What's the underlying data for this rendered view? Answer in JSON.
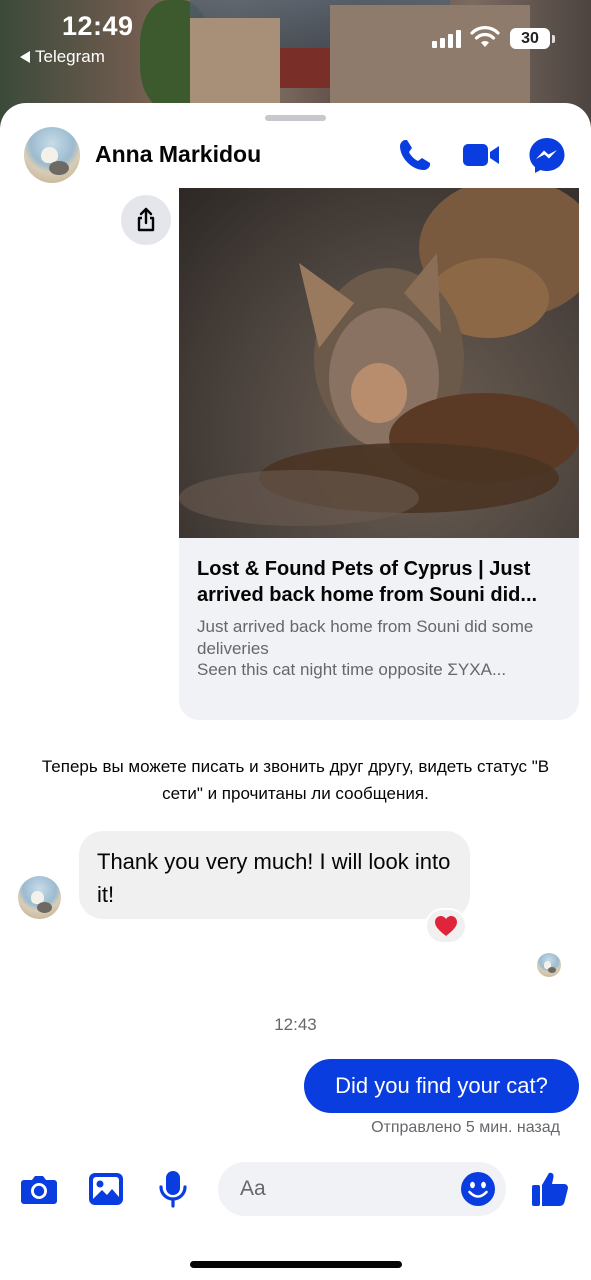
{
  "status_bar": {
    "time": "12:49",
    "back_app": "Telegram",
    "battery": "30"
  },
  "header": {
    "contact_name": "Anna Markidou",
    "icons": [
      "phone-icon",
      "video-camera-icon",
      "messenger-icon"
    ]
  },
  "link_preview": {
    "title": "Lost & Found Pets of Cyprus | Just arrived back home from Souni did...",
    "description": "Just arrived back home from Souni did some deliveries\nSeen this cat night time opposite ΣΥΧΑ..."
  },
  "system_message": "Теперь вы можете писать и звонить друг другу, видеть статус \"В сети\" и прочитаны ли сообщения.",
  "incoming_message": {
    "text": "Thank you very much! I will look into it!",
    "reaction": "heart"
  },
  "timestamp": "12:43",
  "outgoing_message": {
    "text": "Did you find your cat?",
    "status": "Отправлено 5 мин. назад"
  },
  "composer": {
    "placeholder": "Aa",
    "icons": [
      "camera-icon",
      "gallery-icon",
      "microphone-icon",
      "emoji-icon",
      "thumbs-up-icon"
    ]
  },
  "colors": {
    "accent": "#0a3de0",
    "bubble_in": "#f0f0f0",
    "secondary_text": "#65676b"
  }
}
